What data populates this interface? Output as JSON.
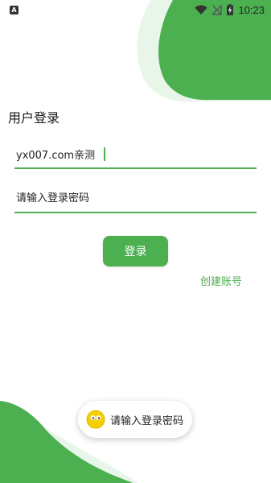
{
  "status_bar": {
    "notification_letter": "A",
    "time": "10:23",
    "icons": [
      "wifi-icon",
      "signal-off-icon",
      "battery-charging-icon"
    ]
  },
  "login": {
    "title": "用户登录",
    "username": {
      "value": "yx007.com亲测",
      "placeholder": ""
    },
    "password": {
      "value": "",
      "placeholder": "请输入登录密码"
    },
    "login_label": "登录",
    "create_account_label": "创建账号"
  },
  "toast": {
    "icon": "emoji-face-icon",
    "message": "请输入登录密码"
  },
  "colors": {
    "accent": "#4caf50",
    "accent_light": "#e8f5e9",
    "text": "#222222",
    "background": "#ffffff"
  }
}
